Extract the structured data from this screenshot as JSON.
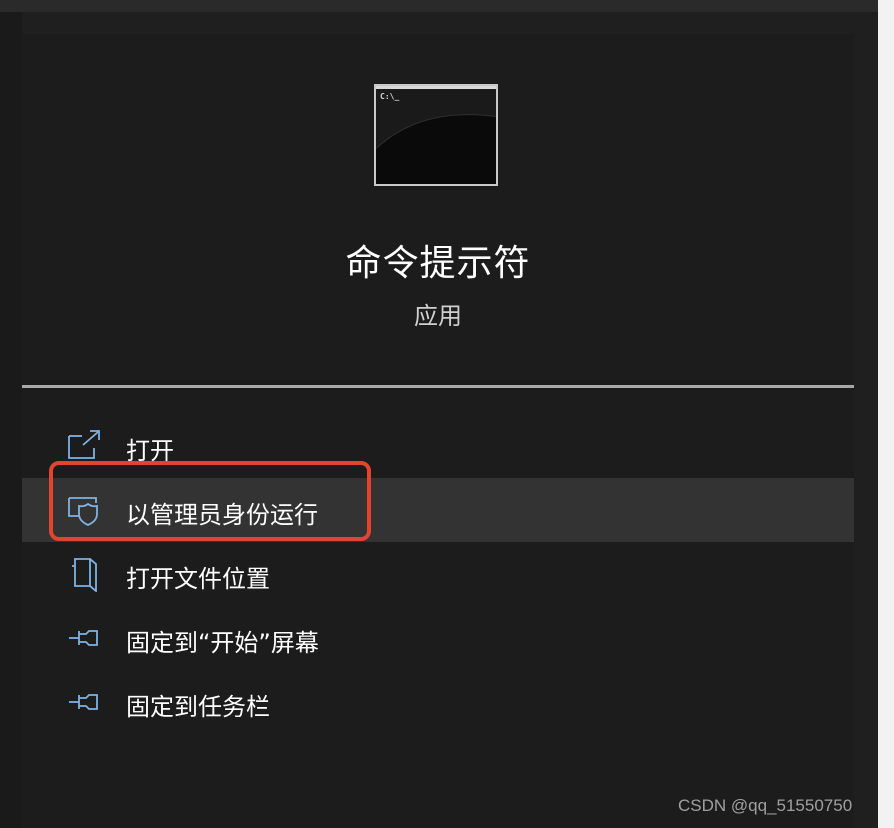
{
  "app": {
    "title": "命令提示符",
    "subtitle": "应用",
    "icon": "command-prompt-icon",
    "icon_prompt_text": "C:\\_"
  },
  "menu": {
    "items": [
      {
        "label": "打开",
        "icon": "open-external-icon"
      },
      {
        "label": "以管理员身份运行",
        "icon": "shield-admin-icon",
        "highlighted": true
      },
      {
        "label": "打开文件位置",
        "icon": "file-location-icon"
      },
      {
        "label": "固定到“开始”屏幕",
        "icon": "pin-icon"
      },
      {
        "label": "固定到任务栏",
        "icon": "pin-icon"
      }
    ]
  },
  "annotation": {
    "color": "#e2452f"
  },
  "colors": {
    "accent_icon": "#7fb2e5",
    "panel_bg": "#1c1c1c",
    "highlight_bg": "#333333"
  },
  "watermark": "CSDN @qq_51550750"
}
